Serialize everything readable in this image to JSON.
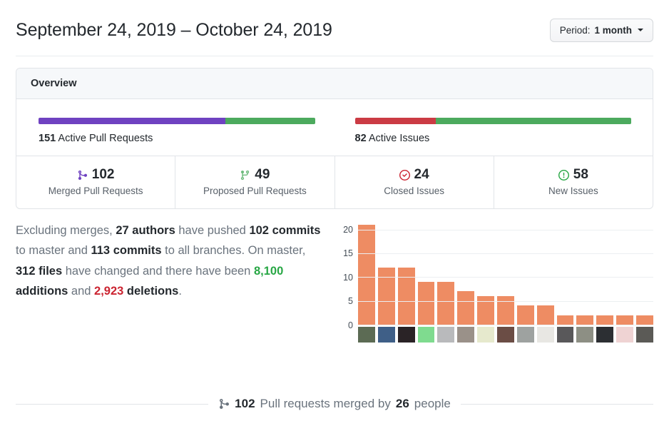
{
  "header": {
    "date_range": "September 24, 2019 – October 24, 2019",
    "period_label": "Period:",
    "period_value": "1 month",
    "caret_icon": "chevron-down-icon"
  },
  "overview": {
    "title": "Overview",
    "bars": [
      {
        "icon": "merged-pull-request-icon",
        "count": "151",
        "label": " Active Pull Requests",
        "segments": [
          {
            "name": "merged",
            "color": "#6f42c1",
            "percent": 67.5
          },
          {
            "name": "proposed",
            "color": "#4caa5e",
            "percent": 32.5
          }
        ]
      },
      {
        "icon": "issue-icon",
        "count": "82",
        "label": " Active Issues",
        "segments": [
          {
            "name": "closed",
            "color": "#cb3b44",
            "percent": 29.3
          },
          {
            "name": "new",
            "color": "#4caa5e",
            "percent": 70.7
          }
        ]
      }
    ],
    "stats": [
      {
        "icon": "git-merge-icon",
        "icon_color": "#6f42c1",
        "value": "102",
        "label": "Merged Pull Requests"
      },
      {
        "icon": "git-branch-icon",
        "icon_color": "#6dbb7d",
        "value": "49",
        "label": "Proposed Pull Requests"
      },
      {
        "icon": "issue-closed-icon",
        "icon_color": "#cb2431",
        "value": "24",
        "label": "Closed Issues"
      },
      {
        "icon": "issue-opened-icon",
        "icon_color": "#28a745",
        "value": "58",
        "label": "New Issues"
      }
    ]
  },
  "commits_summary": {
    "t1": "Excluding merges, ",
    "authors": "27 authors",
    "t2": " have pushed ",
    "commits_master": "102 commits",
    "t3": " to master and ",
    "commits_all": "113 commits",
    "t4": " to all branches. On master, ",
    "files": "312 files",
    "t5": " have changed and there have been ",
    "additions": "8,100",
    "t6": " additions",
    "t7": " and ",
    "deletions": "2,923",
    "t8": " deletions",
    "t9": "."
  },
  "chart_data": {
    "type": "bar",
    "title": "",
    "xlabel": "",
    "ylabel": "",
    "ylim": [
      0,
      21
    ],
    "yticks": [
      0,
      5,
      10,
      15,
      20
    ],
    "grid": true,
    "legend": "none",
    "bar_color": "#ee8c63",
    "categories": [
      "author-1",
      "author-2",
      "author-3",
      "author-4",
      "author-5",
      "author-6",
      "author-7",
      "author-8",
      "author-9",
      "author-10",
      "author-11",
      "author-12",
      "author-13",
      "author-14",
      "author-15"
    ],
    "values": [
      21,
      12,
      12,
      9,
      9,
      7,
      6,
      6,
      4,
      4,
      2,
      2,
      2,
      2,
      2
    ],
    "tick_labels": [
      "avatar",
      "avatar",
      "avatar",
      "avatar",
      "avatar",
      "avatar",
      "avatar",
      "avatar",
      "avatar",
      "avatar",
      "avatar",
      "avatar",
      "avatar",
      "avatar",
      "avatar"
    ],
    "avatar_colors": [
      "#5c6b54",
      "#3f5f87",
      "#2a2326",
      "#7fdb8f",
      "#b9babc",
      "#9a9189",
      "#e6e9cd",
      "#6b4d45",
      "#9ea2a0",
      "#e8e7e3",
      "#59585a",
      "#8d8f84",
      "#2c2f33",
      "#efd3d3",
      "#5b5a56"
    ]
  },
  "footer": {
    "icon": "git-merge-icon",
    "count": "102",
    "t1": " Pull requests merged by ",
    "people": "26",
    "t2": " people"
  }
}
